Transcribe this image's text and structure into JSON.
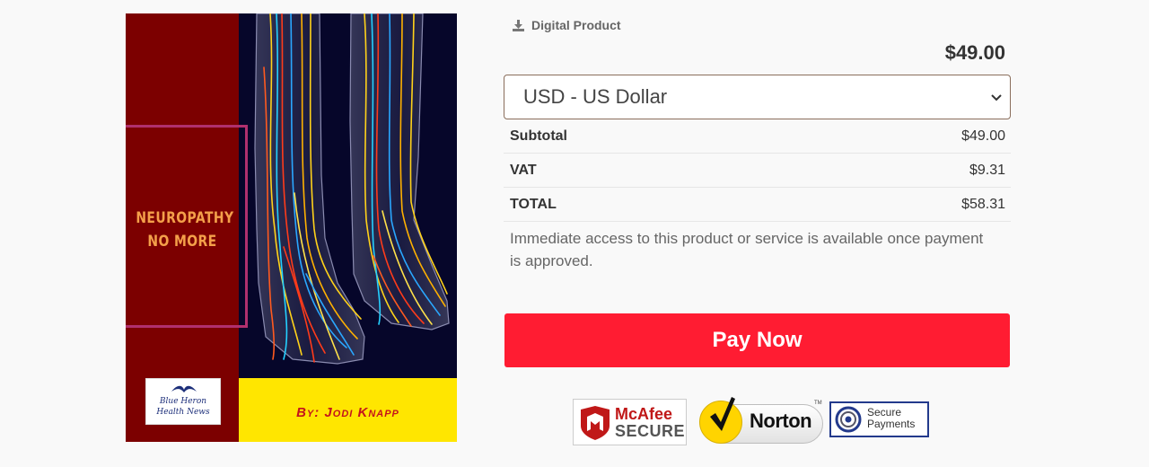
{
  "cover": {
    "title_line1": "NEUROPATHY",
    "title_line2": "NO MORE",
    "author": "By: Jodi Knapp",
    "publisher_line1": "Blue Heron",
    "publisher_line2": "Health News",
    "colors": {
      "left_panel": "#7c0000",
      "bottom_band": "#ffe600",
      "title": "#f4a04a",
      "author": "#c4141c",
      "background": "#06062a"
    }
  },
  "product": {
    "type_label": "Digital Product",
    "type_icon": "download-icon",
    "price": "$49.00"
  },
  "currency": {
    "selected": "USD - US Dollar",
    "icon": "chevron-down-icon"
  },
  "summary": {
    "rows": [
      {
        "label": "Subtotal",
        "value": "$49.00"
      },
      {
        "label": "VAT",
        "value": "$9.31"
      },
      {
        "label": "TOTAL",
        "value": "$58.31"
      }
    ]
  },
  "note": "Immediate access to this product or service is available once payment is approved.",
  "pay_button": {
    "label": "Pay Now",
    "color": "#ff1c32"
  },
  "badges": {
    "mcafee_line1": "McAfee",
    "mcafee_line2": "SECURE",
    "norton": "Norton",
    "norton_tm": "TM",
    "secure_line1": "Secure",
    "secure_line2": "Payments"
  }
}
